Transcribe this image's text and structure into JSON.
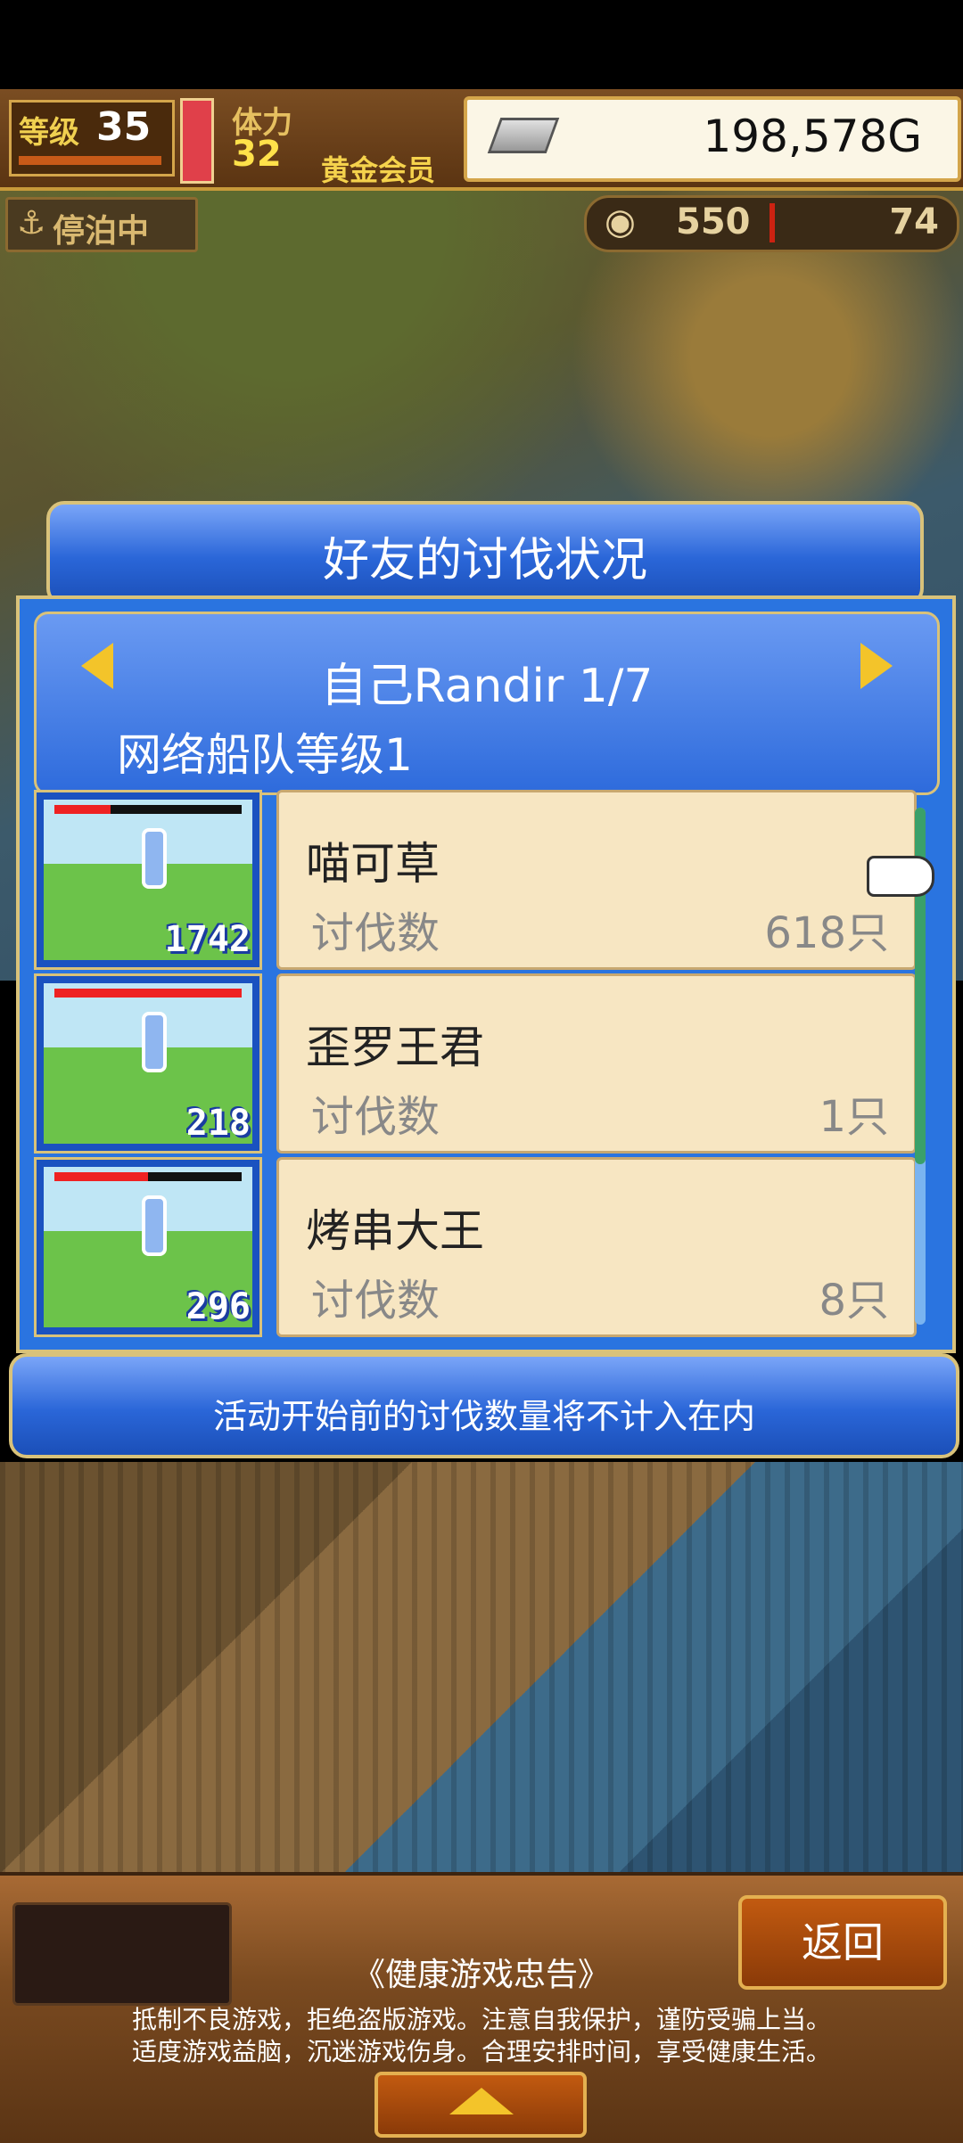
{
  "hud": {
    "level_label": "等级",
    "level": "35",
    "stamina_label": "体力",
    "stamina": "32",
    "vip": "黄金会员",
    "gold": "198,578G",
    "status": "停泊中",
    "resource_a": "550",
    "resource_b": "74"
  },
  "dialog": {
    "title": "好友的讨伐状况",
    "player_name": "自己Randir 1/7",
    "fleet_level": "网络船队等级1",
    "note": "活动开始前的讨伐数量将不计入在内",
    "entries": [
      {
        "name": "喵可草",
        "kill_label": "讨伐数",
        "kills": "618只",
        "thumb_count": "1742",
        "hp_fraction": 0.3
      },
      {
        "name": "歪罗王君",
        "kill_label": "讨伐数",
        "kills": "1只",
        "thumb_count": "218",
        "hp_fraction": 1.0
      },
      {
        "name": "烤串大王",
        "kill_label": "讨伐数",
        "kills": "8只",
        "thumb_count": "296",
        "hp_fraction": 0.5
      }
    ]
  },
  "footer": {
    "back_label": "返回",
    "health_title": "《健康游戏忠告》",
    "health_line1": "抵制不良游戏，拒绝盗版游戏。注意自我保护，谨防受骗上当。",
    "health_line2": "适度游戏益脑，沉迷游戏伤身。合理安排时间，享受健康生活。"
  }
}
